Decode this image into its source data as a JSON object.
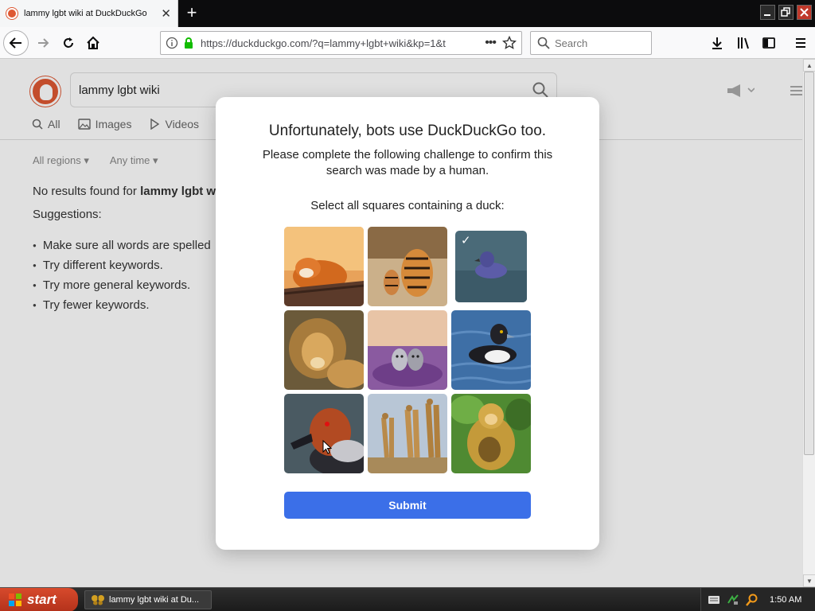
{
  "browser": {
    "tab_title": "lammy lgbt wiki at DuckDuckGo",
    "tab_close": "✕",
    "newtab": "+",
    "url": "https://duckduckgo.com/?q=lammy+lgbt+wiki&kp=1&t",
    "url_more": "•••",
    "search_placeholder": "Search"
  },
  "page": {
    "search_query": "lammy lgbt wiki",
    "tabs": [
      "All",
      "Images",
      "Videos"
    ],
    "filters": [
      "All regions",
      "Any time"
    ],
    "no_results_prefix": "No results found for ",
    "no_results_query": "lammy lgbt wi",
    "suggestions_label": "Suggestions:",
    "suggestions": [
      "Make sure all words are spelled",
      "Try different keywords.",
      "Try more general keywords.",
      "Try fewer keywords."
    ]
  },
  "modal": {
    "title": "Unfortunately, bots use DuckDuckGo too.",
    "subtitle": "Please complete the following challenge to confirm this search was made by a human.",
    "instruction": "Select all squares containing a duck:",
    "tiles": [
      {
        "subject": "fox",
        "selected": false
      },
      {
        "subject": "tigers",
        "selected": false
      },
      {
        "subject": "duck-blue",
        "selected": true
      },
      {
        "subject": "lion",
        "selected": false
      },
      {
        "subject": "wolves",
        "selected": false
      },
      {
        "subject": "duck-swimming",
        "selected": false
      },
      {
        "subject": "duck-redhead",
        "selected": false
      },
      {
        "subject": "giraffes",
        "selected": false
      },
      {
        "subject": "baboon",
        "selected": false
      }
    ],
    "check_mark": "✓",
    "submit_label": "Submit"
  },
  "taskbar": {
    "start_label": "start",
    "task_label": "lammy lgbt wiki at Du...",
    "clock": "1:50 AM"
  },
  "colors": {
    "ddg_orange": "#de5833",
    "submit_blue": "#3b6fe8",
    "start_red": "#c63d21"
  }
}
